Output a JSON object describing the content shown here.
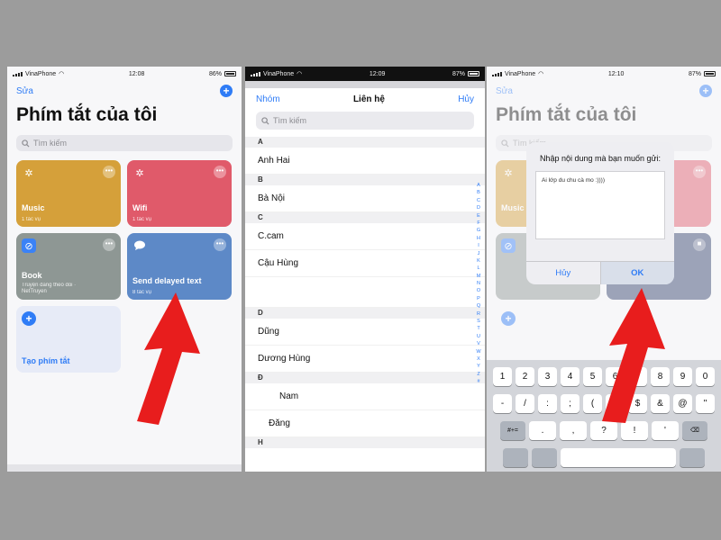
{
  "status": {
    "carrier": "VinaPhone",
    "p1_time": "12:08",
    "p1_battery": "86%",
    "p2_time": "12:09",
    "p2_battery": "87%",
    "p3_time": "12:10",
    "p3_battery": "87%"
  },
  "shortcuts": {
    "edit_label": "Sửa",
    "add_icon": "plus-icon",
    "title": "Phím tắt của tôi",
    "search_placeholder": "Tìm kiếm",
    "cards": [
      {
        "name": "Music",
        "subtitle": "1 tác vụ",
        "color": "#d5a03a",
        "icon": "magic-wand-icon"
      },
      {
        "name": "Wifi",
        "subtitle": "1 tác vụ",
        "color": "#e05a6a",
        "icon": "magic-wand-icon"
      },
      {
        "name": "Book",
        "subtitle": "Truyện đang theo dõi · NetTruyen",
        "color": "#8e9794",
        "icon": "safari-icon"
      },
      {
        "name": "Send delayed text",
        "subtitle": "8 tác vụ",
        "color": "#5d89c7",
        "icon": "message-icon"
      }
    ],
    "create_label": "Tạo phím tắt"
  },
  "contacts": {
    "left_label": "Nhóm",
    "title": "Liên hệ",
    "cancel_label": "Hủy",
    "search_placeholder": "Tìm kiếm",
    "sections": [
      {
        "letter": "A",
        "rows": [
          "Anh Hai"
        ]
      },
      {
        "letter": "B",
        "rows": [
          "Bà Nội"
        ]
      },
      {
        "letter": "C",
        "rows": [
          "C.cam",
          "Cậu Hùng"
        ]
      },
      {
        "letter": "D",
        "rows": [
          "Dũng",
          "Dương Hùng"
        ]
      },
      {
        "letter": "Đ",
        "rows": [
          "Nam",
          "Đăng"
        ]
      },
      {
        "letter": "H",
        "rows": []
      }
    ],
    "index_letters": [
      "A",
      "B",
      "C",
      "D",
      "E",
      "F",
      "G",
      "H",
      "I",
      "J",
      "K",
      "L",
      "M",
      "N",
      "O",
      "P",
      "Q",
      "R",
      "S",
      "T",
      "U",
      "V",
      "W",
      "X",
      "Y",
      "Z",
      "#"
    ]
  },
  "dialog": {
    "title": "Nhập nội dung mà bạn muốn gửi:",
    "text": "Ai lớp du chu cà mo :))))",
    "cancel_label": "Hủy",
    "ok_label": "OK"
  },
  "keyboard": {
    "row1": [
      "1",
      "2",
      "3",
      "4",
      "5",
      "6",
      "7",
      "8",
      "9",
      "0"
    ],
    "row2": [
      "-",
      "/",
      ":",
      ";",
      "(",
      ")",
      "$",
      "&",
      "@",
      "\""
    ],
    "row3": [
      "#+=",
      ".",
      ",",
      "?",
      "!",
      "'",
      "⌫"
    ]
  },
  "colors": {
    "accent": "#2f7cf6",
    "arrow": "#e81d1d",
    "background": "#9c9c9c"
  }
}
